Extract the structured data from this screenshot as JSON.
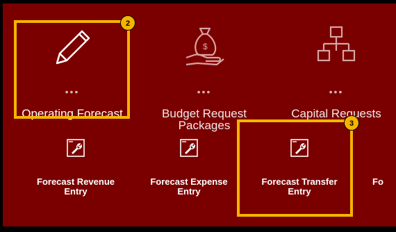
{
  "tiles": [
    {
      "label": "Operating Forecast",
      "icon": "pencil-icon"
    },
    {
      "label": "Budget Request Packages",
      "icon": "money-bag-hand-icon"
    },
    {
      "label": "Capital Requests",
      "icon": "org-chart-icon"
    }
  ],
  "dots": "•••",
  "tasks": [
    {
      "label": "Forecast Revenue Entry",
      "icon": "wrench-form-icon"
    },
    {
      "label": "Forecast Expense Entry",
      "icon": "wrench-form-icon"
    },
    {
      "label": "Forecast Transfer Entry",
      "icon": "wrench-form-icon"
    },
    {
      "label": "Fo",
      "icon": "wrench-form-icon"
    }
  ],
  "callouts": [
    {
      "number": "2"
    },
    {
      "number": "3"
    }
  ],
  "colors": {
    "panel": "#7a0000",
    "highlight": "#f5b400"
  }
}
